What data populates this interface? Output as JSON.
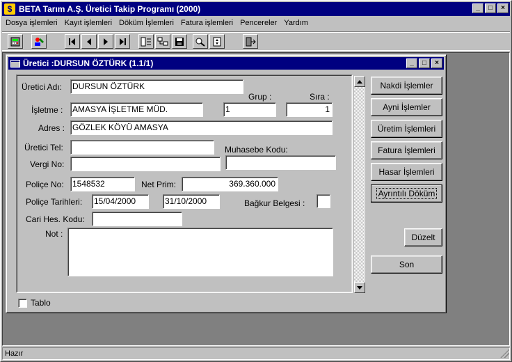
{
  "app": {
    "title": "BETA Tarım A.Ş. Üretici Takip Programı (2000)",
    "icon_glyph": "$"
  },
  "window_controls": {
    "minimize": "_",
    "maximize": "□",
    "close": "×"
  },
  "menu": [
    "Dosya işlemleri",
    "Kayıt işlemleri",
    "Döküm İşlemleri",
    "Fatura işlemleri",
    "Pencereler",
    "Yardım"
  ],
  "toolbar": {
    "icons": [
      "calculator-icon",
      "user-edit-icon",
      "first-record-icon",
      "previous-record-icon",
      "next-record-icon",
      "last-record-icon",
      "list-icon",
      "tree-icon",
      "save-icon",
      "search-icon",
      "scroll-icon",
      "exit-icon"
    ]
  },
  "child": {
    "title": "Üretici :DURSUN ÖZTÜRK (1.1/1)"
  },
  "form": {
    "uretici_adi_label": "Üretici Adı:",
    "uretici_adi": "DURSUN ÖZTÜRK",
    "grup_label": "Grup :",
    "sira_label": "Sıra :",
    "isletme_label": "İşletme  :",
    "isletme": "AMASYA İŞLETME MÜD.",
    "grup": "1",
    "sira": "1",
    "adres_label": "Adres :",
    "adres": "GÖZLEK KÖYÜ  AMASYA",
    "tel_label": "Üretici Tel:",
    "tel": "",
    "muhasebe_label": "Muhasebe Kodu:",
    "muhasebe": "",
    "vergi_label": "Vergi No:",
    "vergi": "",
    "police_no_label": "Poliçe No:",
    "police_no": "1548532",
    "net_prim_label": "Net Prim:",
    "net_prim": "369.360.000",
    "police_tarih_label": "Poliçe Tarihleri:",
    "tarih_bas": "15/04/2000",
    "tarih_bit": "31/10/2000",
    "bagkur_label": "Bağkur Belgesi :",
    "cari_label": "Cari Hes. Kodu:",
    "cari": "",
    "not_label": "Not :",
    "not": ""
  },
  "buttons": {
    "nakdi": "Nakdi İşlemler",
    "ayni": "Ayni İşlemler",
    "uretim": "Üretim İşlemleri",
    "fatura": "Fatura İşlemleri",
    "hasar": "Hasar İşlemleri",
    "dokum": "Ayrıntılı Döküm",
    "duzelt": "Düzelt",
    "son": "Son"
  },
  "tablo_label": "Tablo",
  "status": "Hazır"
}
